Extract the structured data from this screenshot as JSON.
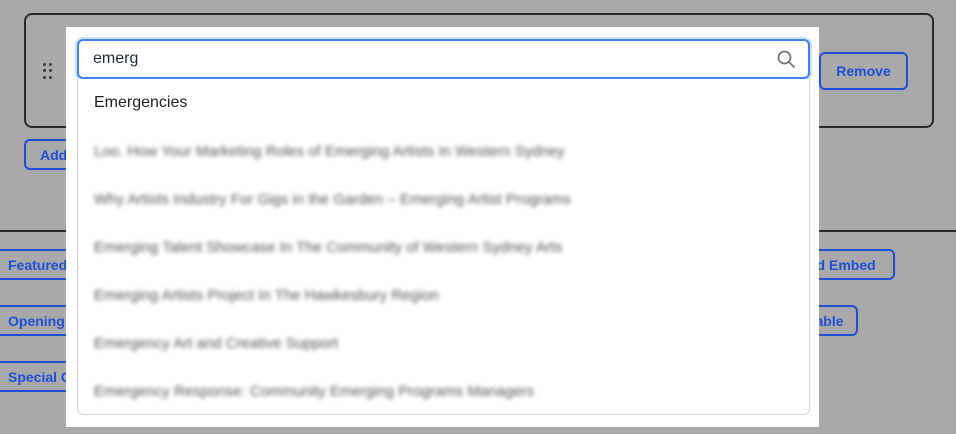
{
  "background": {
    "remove_label": "Remove",
    "add_label": "Add a",
    "left_buttons": [
      "Featured C",
      "Opening Ho",
      "Special Co"
    ],
    "right_buttons": [
      "dd Embed",
      "Table"
    ]
  },
  "search": {
    "value": "emerg",
    "icon": "search-icon"
  },
  "results": [
    "Emergencies",
    "Loo. How Your Marketing Roles of Emerging Artists In Western Sydney",
    "Why Artists Industry For Gigs in the Garden – Emerging Artist Programs",
    "Emerging Talent Showcase In The Community of Western Sydney Arts",
    "Emerging Artists Project In The Hawkesbury Region",
    "Emergency Art and Creative Support",
    "Emergency Response: Community Emerging Programs Managers"
  ]
}
